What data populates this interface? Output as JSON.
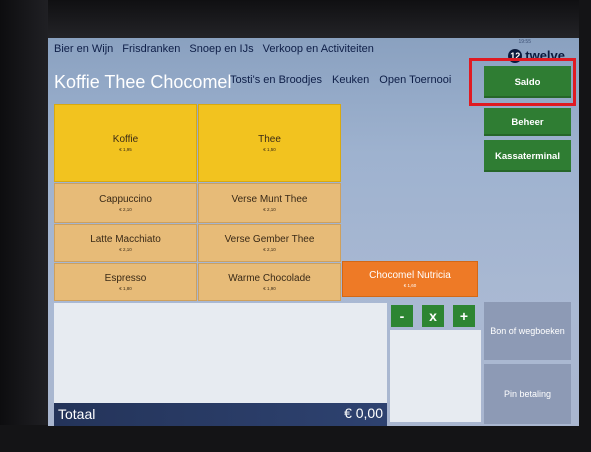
{
  "topnav": [
    "Bier en Wijn",
    "Frisdranken",
    "Snoep en IJs",
    "Verkoop en Activiteiten"
  ],
  "logo": {
    "time": "19:55",
    "mark": "12",
    "word": "twelve"
  },
  "category_title": "Koffie Thee Chocomel",
  "subnav": [
    "Tosti's en Broodjes",
    "Keuken",
    "Open Toernooi"
  ],
  "side_buttons": {
    "saldo": "Saldo",
    "beheer": "Beheer",
    "kassaterminal": "Kassaterminal"
  },
  "products": [
    {
      "name": "Koffie",
      "price": "€ 1,95"
    },
    {
      "name": "Thee",
      "price": "€ 1,50"
    },
    {
      "name": "Cappuccino",
      "price": "€ 2,10"
    },
    {
      "name": "Verse Munt Thee",
      "price": "€ 2,10"
    },
    {
      "name": "Latte Macchiato",
      "price": "€ 2,10"
    },
    {
      "name": "Verse Gember Thee",
      "price": "€ 2,10"
    },
    {
      "name": "Espresso",
      "price": "€ 1,80"
    },
    {
      "name": "Warme Chocolade",
      "price": "€ 1,90"
    },
    {
      "name": "Chocomel Nutricia",
      "price": "€ 1,60"
    }
  ],
  "qty_controls": {
    "minus": "-",
    "remove": "x",
    "plus": "+"
  },
  "payment": {
    "bon": "Bon of wegboeken",
    "pin": "Pin betaling"
  },
  "total": {
    "label": "Totaal",
    "amount": "€ 0,00"
  },
  "colors": {
    "accent_green": "#2f7d33",
    "highlight_red": "#e01a22",
    "total_bar": "#2a3c66"
  }
}
